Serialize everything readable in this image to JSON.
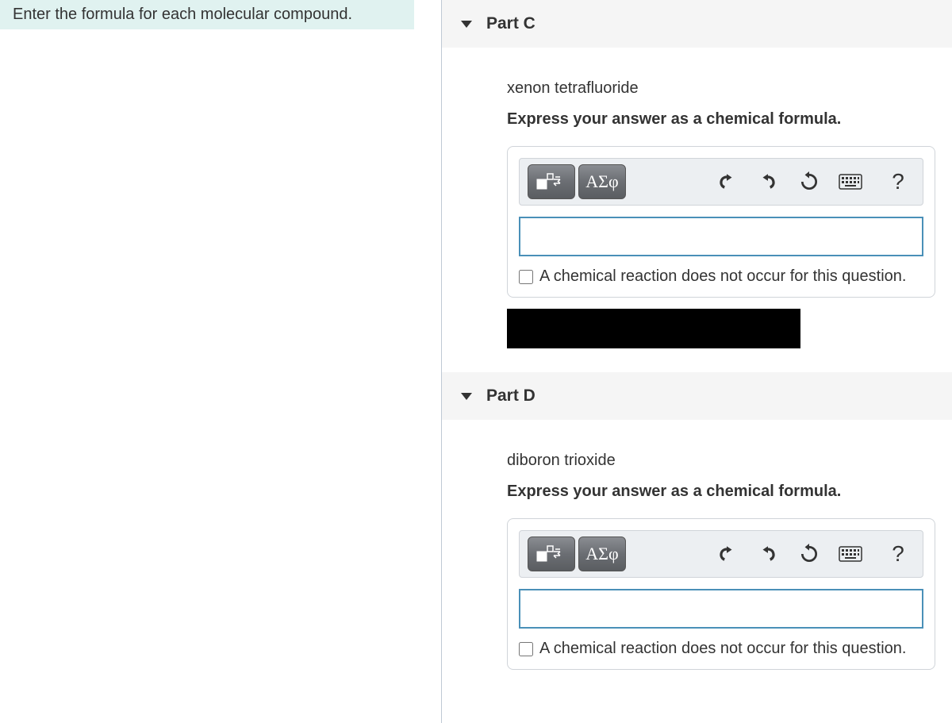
{
  "prompt": "Enter the formula for each molecular compound.",
  "parts": [
    {
      "label": "Part C",
      "compound": "xenon tetrafluoride",
      "instruction": "Express your answer as a chemical formula.",
      "greek_button": "ΑΣφ",
      "help_symbol": "?",
      "no_reaction_label": "A chemical reaction does not occur for this question.",
      "answer": ""
    },
    {
      "label": "Part D",
      "compound": "diboron trioxide",
      "instruction": "Express your answer as a chemical formula.",
      "greek_button": "ΑΣφ",
      "help_symbol": "?",
      "no_reaction_label": "A chemical reaction does not occur for this question.",
      "answer": ""
    }
  ]
}
